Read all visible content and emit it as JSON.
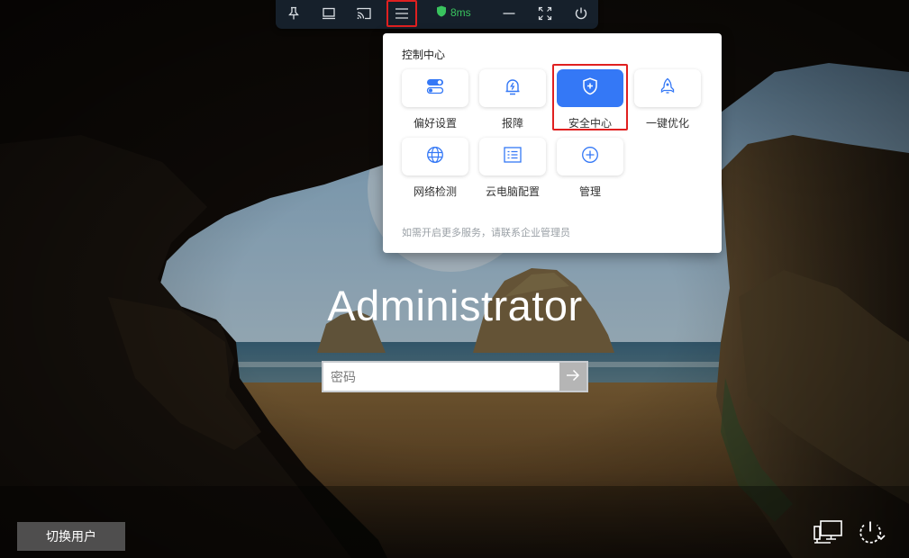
{
  "toolbar": {
    "buttons": [
      {
        "name": "pin-icon"
      },
      {
        "name": "monitor-icon"
      },
      {
        "name": "cast-icon"
      },
      {
        "name": "menu-icon",
        "active": true
      },
      {
        "name": "minimize-icon"
      },
      {
        "name": "fullscreen-icon"
      },
      {
        "name": "power-icon"
      }
    ],
    "latency": "8ms",
    "latency_color": "#39c35e"
  },
  "control_center": {
    "title": "控制中心",
    "items": [
      {
        "label": "偏好设置",
        "icon": "toggle-settings-icon"
      },
      {
        "label": "报障",
        "icon": "report-fault-icon"
      },
      {
        "label": "安全中心",
        "icon": "shield-icon",
        "selected": true
      },
      {
        "label": "一键优化",
        "icon": "rocket-icon"
      },
      {
        "label": "网络检测",
        "icon": "globe-icon"
      },
      {
        "label": "云电脑配置",
        "icon": "config-list-icon"
      },
      {
        "label": "管理",
        "icon": "plus-circle-icon"
      }
    ],
    "note": "如需开启更多服务，请联系企业管理员",
    "accent": "#3478f6"
  },
  "login": {
    "username": "Administrator",
    "password_placeholder": "密码"
  },
  "bottom": {
    "switch_user": "切换用户",
    "icons": [
      "network-icon",
      "power-options-icon"
    ]
  },
  "highlight_color": "#e02020"
}
